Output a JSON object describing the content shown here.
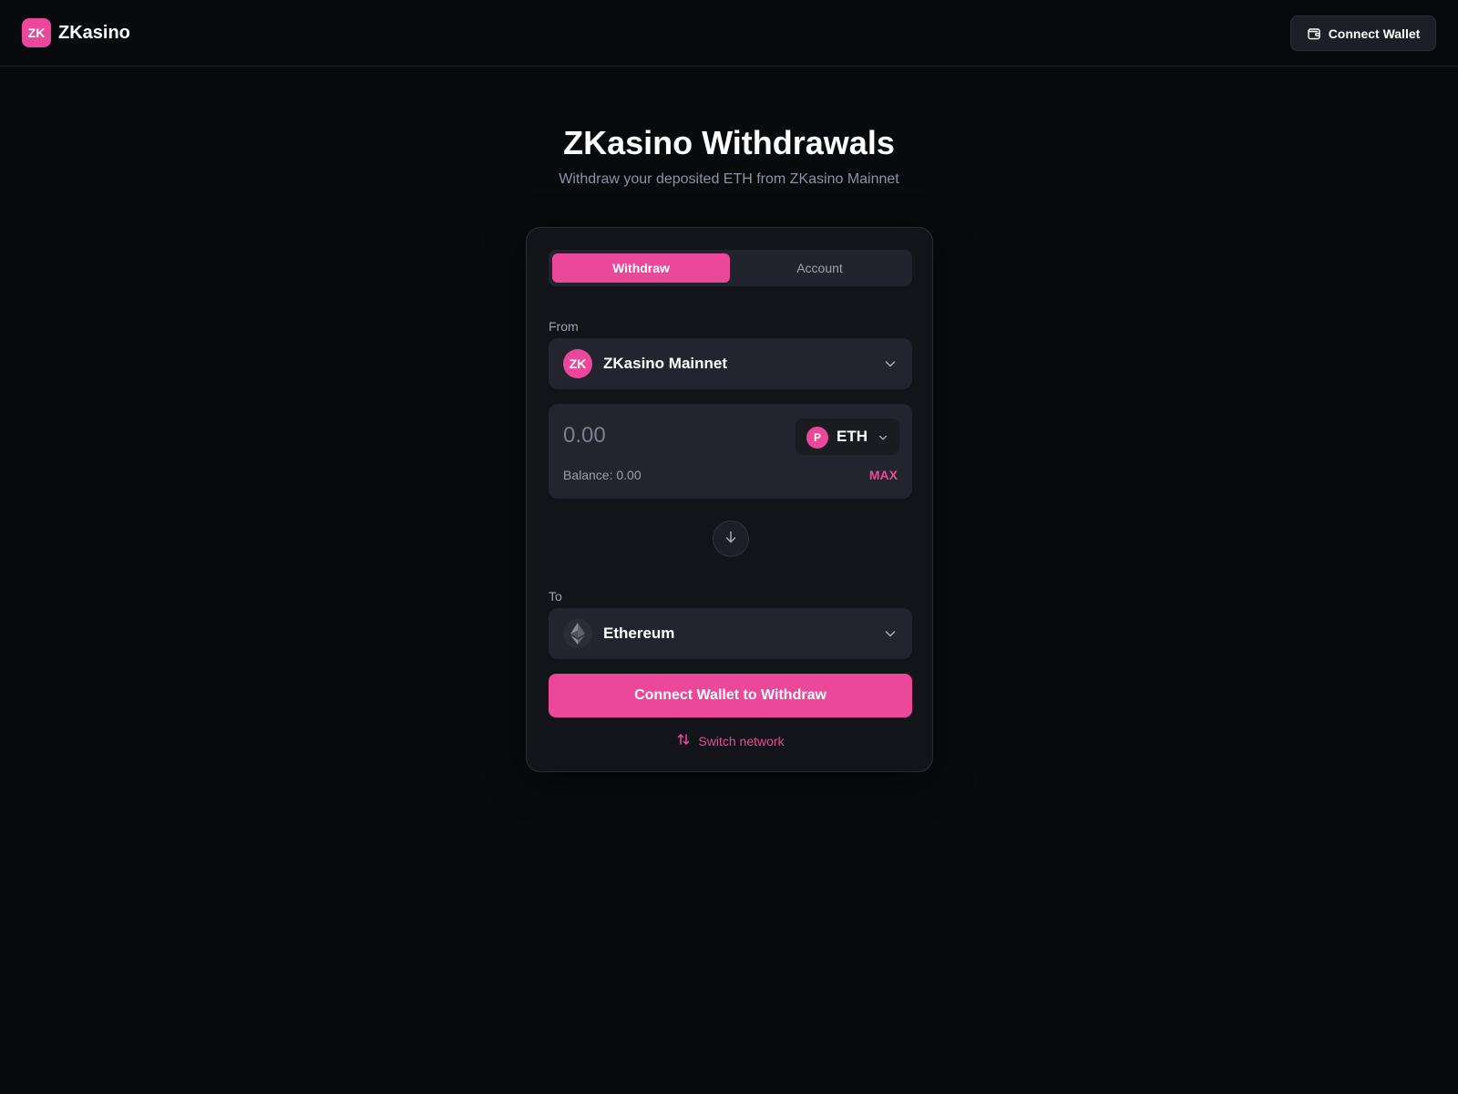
{
  "header": {
    "logo_badge": "ZK",
    "brand": "ZKasino",
    "connect_wallet_label": "Connect Wallet",
    "wallet_icon": "wallet-icon"
  },
  "hero": {
    "title": "ZKasino Withdrawals",
    "subtitle": "Withdraw your deposited ETH from ZKasino Mainnet"
  },
  "card": {
    "tabs": [
      {
        "label": "Withdraw",
        "active": true
      },
      {
        "label": "Account",
        "active": false
      }
    ],
    "from": {
      "label": "From",
      "network_badge": "ZK",
      "network": "ZKasino Mainnet",
      "chevron_icon": "chevron-down-icon"
    },
    "amount": {
      "value": "",
      "placeholder": "0.00",
      "token_badge": "P",
      "token": "ETH",
      "balance": "Balance: 0.00",
      "max_label": "MAX"
    },
    "swap_icon": "arrow-down-icon",
    "to": {
      "label": "To",
      "network": "Ethereum",
      "network_icon": "ethereum-icon",
      "chevron_icon": "chevron-down-icon"
    },
    "cta_label": "Connect Wallet to Withdraw",
    "switch_label": "Switch network",
    "switch_icon": "arrows-up-down-icon"
  },
  "colors": {
    "background": "#090a0d",
    "card": "#121419",
    "field": "#22252d",
    "accent": "#ec4899",
    "muted_text": "#9aa0ad"
  }
}
